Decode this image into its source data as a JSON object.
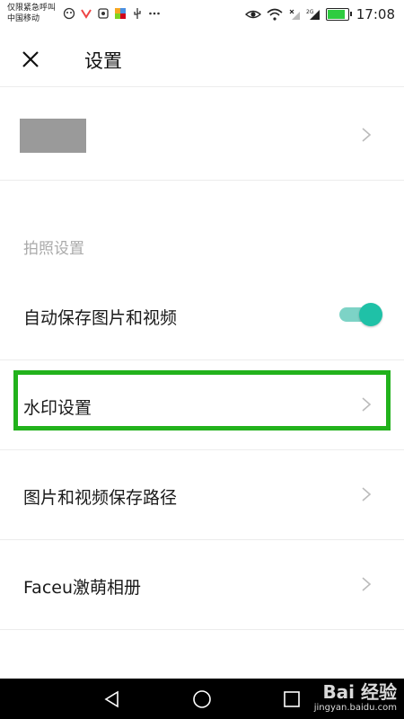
{
  "status_bar": {
    "carrier_line1": "仅限紧急呼叫",
    "carrier_line2": "中国移动",
    "time": "17:08",
    "signal_label": "2G",
    "icons": [
      "notification-icon",
      "app-icon",
      "app-icon",
      "app-icon",
      "usb-icon",
      "more-icon",
      "eye-icon",
      "wifi-icon",
      "no-signal-icon",
      "signal-icon",
      "battery-icon"
    ]
  },
  "app_bar": {
    "title": "设置",
    "close_icon": "close-icon"
  },
  "section": {
    "title": "拍照设置"
  },
  "settings": [
    {
      "label": "自动保存图片和视频",
      "control": "toggle",
      "on": true
    },
    {
      "label": "水印设置",
      "control": "chevron"
    },
    {
      "label": "图片和视频保存路径",
      "control": "chevron"
    },
    {
      "label": "Faceu激萌相册",
      "control": "chevron"
    }
  ],
  "colors": {
    "accent": "#1fc1a7",
    "highlight": "#22b21c"
  },
  "watermark": {
    "main": "Bai 经验",
    "sub": "jingyan.baidu.com"
  },
  "nav_bar": {
    "buttons": [
      "back-icon",
      "home-icon",
      "recents-icon"
    ]
  }
}
